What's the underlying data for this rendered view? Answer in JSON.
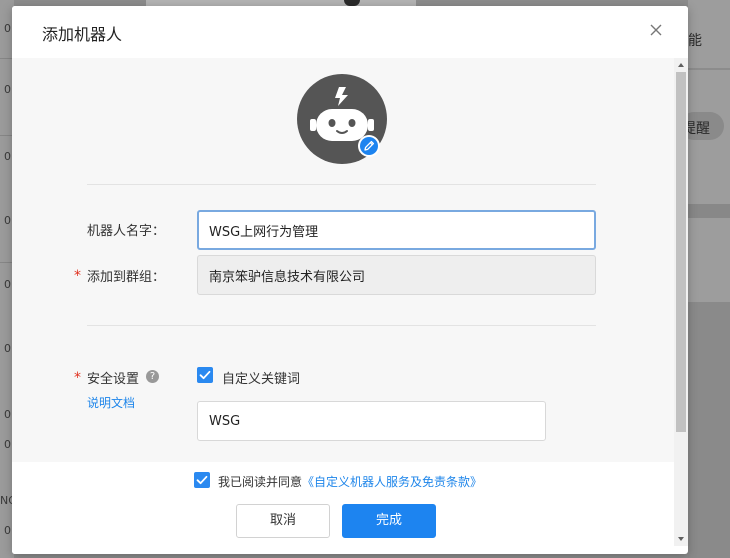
{
  "dialog": {
    "title": "添加机器人"
  },
  "form": {
    "name_label": "机器人名字：",
    "name_value": "WSG上网行为管理",
    "group_label": "添加到群组：",
    "group_value": "南京笨驴信息技术有限公司",
    "security_label": "安全设置",
    "doc_link": "说明文档",
    "keyword_option": "自定义关键词",
    "keyword_value": "WSG",
    "partial_hint": "· · · · · · · · · · · ·"
  },
  "footer": {
    "agree_text": "我已阅读并同意",
    "agree_link": "《自定义机器人服务及免责条款》",
    "cancel_label": "取消",
    "ok_label": "完成"
  },
  "background": {
    "right_text_1": "能",
    "right_text_2": "提醒",
    "left_digit": "0",
    "left_text_ng": "NG"
  },
  "icons": {
    "close": "close-icon",
    "robot_avatar": "robot-avatar-icon",
    "edit": "pencil-icon",
    "help": "question-icon",
    "checkbox": "checkmark-icon"
  },
  "colors": {
    "accent": "#1d84f0",
    "required": "#e0301e",
    "avatar_bg": "#555555"
  }
}
